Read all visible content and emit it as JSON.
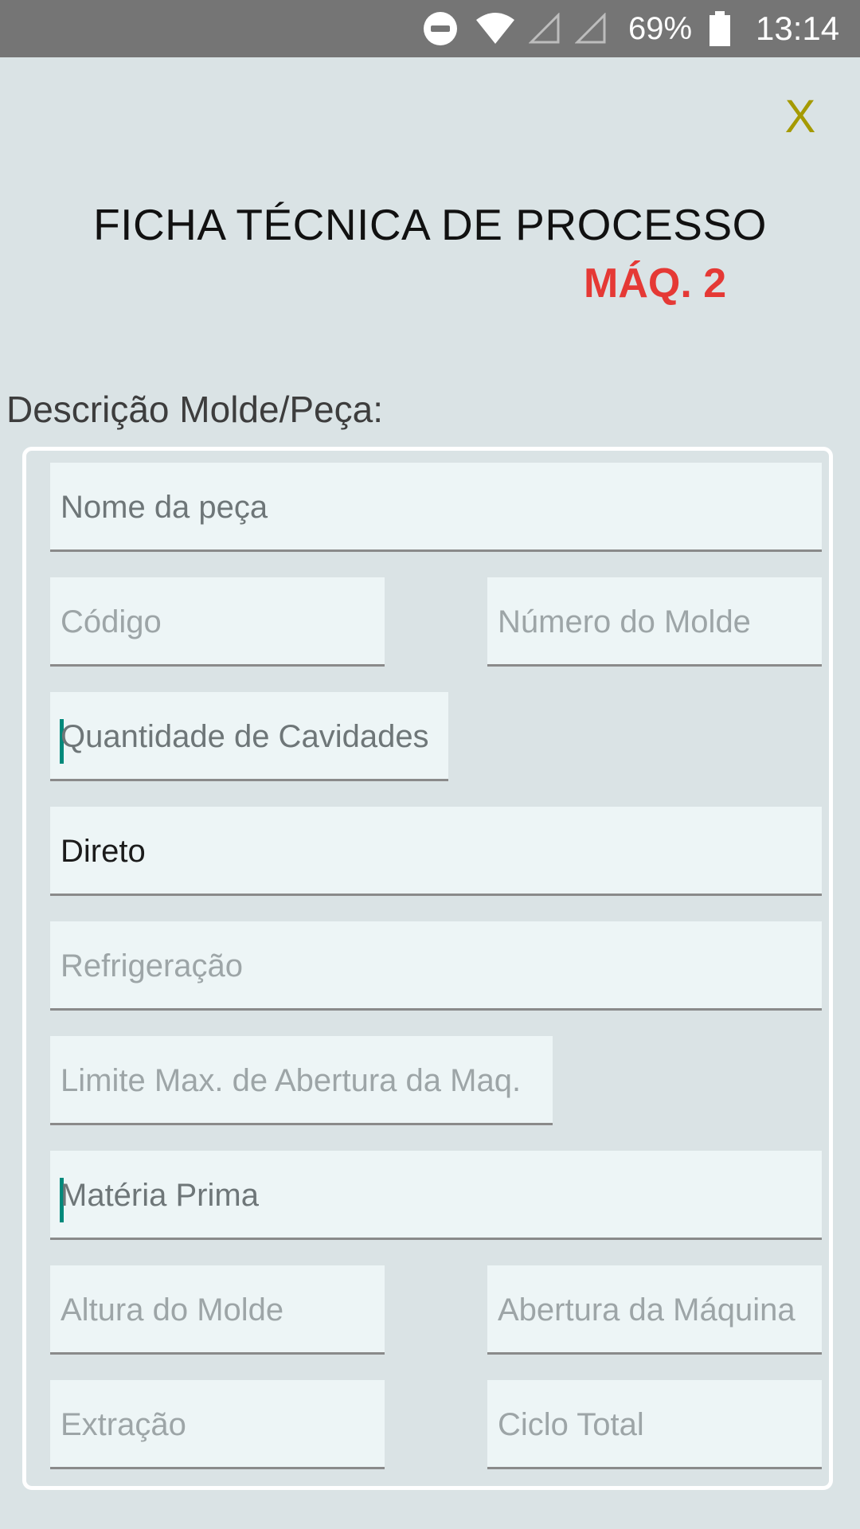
{
  "status_bar": {
    "dnd_icon": "do-not-disturb-icon",
    "wifi_icon": "wifi-icon",
    "signal_icons": [
      "signal-empty-icon",
      "signal-empty-icon"
    ],
    "battery_percent": "69%",
    "battery_icon": "battery-icon",
    "time": "13:14"
  },
  "header": {
    "close_label": "X",
    "title": "FICHA TÉCNICA DE PROCESSO",
    "subtitle": "MÁQ. 2"
  },
  "section": {
    "label": "Descrição Molde/Peça:"
  },
  "fields": {
    "nome_peca": {
      "placeholder": "Nome da peça",
      "value": ""
    },
    "codigo": {
      "placeholder": "Código",
      "value": ""
    },
    "numero_molde": {
      "placeholder": "Número do Molde",
      "value": ""
    },
    "quantidade_cavidades": {
      "placeholder": "Quantidade de Cavidades",
      "value": ""
    },
    "tipo_injecao": {
      "placeholder": "",
      "value": "Direto"
    },
    "refrigeracao": {
      "placeholder": "Refrigeração",
      "value": ""
    },
    "limite_abertura": {
      "placeholder": "Limite Max. de Abertura da Maq.",
      "value": ""
    },
    "materia_prima": {
      "placeholder": "Matéria Prima",
      "value": ""
    },
    "altura_molde": {
      "placeholder": "Altura do Molde",
      "value": ""
    },
    "abertura_maquina": {
      "placeholder": "Abertura da Máquina",
      "value": ""
    },
    "extracao": {
      "placeholder": "Extração",
      "value": ""
    },
    "ciclo_total": {
      "placeholder": "Ciclo Total",
      "value": ""
    }
  },
  "colors": {
    "background": "#dae3e5",
    "field_background": "#edf5f6",
    "close_button": "#a59a00",
    "subtitle": "#e53935",
    "cursor": "#00897b",
    "status_bar": "#757575"
  }
}
